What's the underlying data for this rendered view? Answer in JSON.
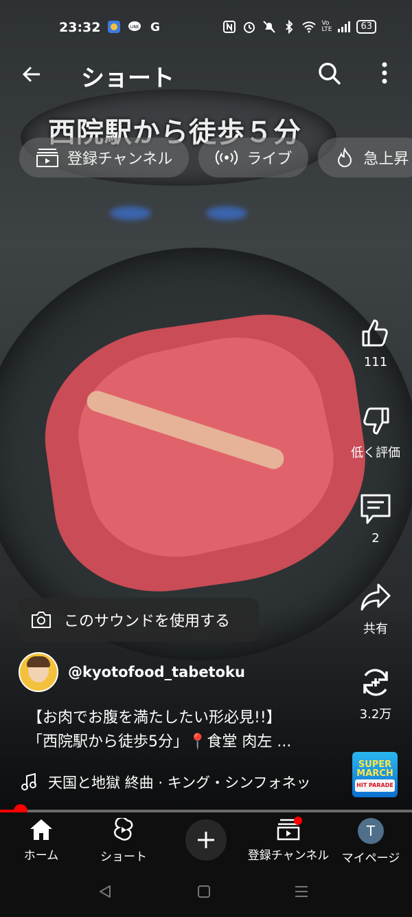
{
  "status": {
    "time": "23:32",
    "battery": "63",
    "network": "Vo\nLTE"
  },
  "header": {
    "title": "ショート"
  },
  "video": {
    "overlay_title": "西院駅から徒歩５分"
  },
  "chips": [
    {
      "label": "登録チャンネル",
      "icon": "subscriptions-icon"
    },
    {
      "label": "ライブ",
      "icon": "live-icon"
    },
    {
      "label": "急上昇",
      "icon": "trending-icon"
    }
  ],
  "actions": {
    "like_count": "111",
    "dislike_label": "低く評価",
    "comment_count": "2",
    "share_label": "共有",
    "remix_count": "3.2万"
  },
  "sound_button": {
    "label": "このサウンドを使用する"
  },
  "channel": {
    "handle": "@kyotofood_tabetoku"
  },
  "description": {
    "line1": "【お肉でお腹を満たしたい形必見!!】",
    "line2": "「西院駅から徒歩5分」📍食堂 肉左 ..."
  },
  "music": {
    "track": "天国と地獄 終曲 · キング・シンフォネッ"
  },
  "music_thumb": {
    "line1": "SUPER MARCH",
    "line2": "HIT PARADE"
  },
  "progress": {
    "fraction": 0.05
  },
  "bottom_nav": {
    "home": "ホーム",
    "shorts": "ショート",
    "subscriptions": "登録チャンネル",
    "mypage": "マイページ",
    "avatar_letter": "T"
  },
  "colors": {
    "accent": "#ff0000",
    "nav_bg": "#0f0f0f",
    "chip_bg": "#6e6e6e"
  }
}
